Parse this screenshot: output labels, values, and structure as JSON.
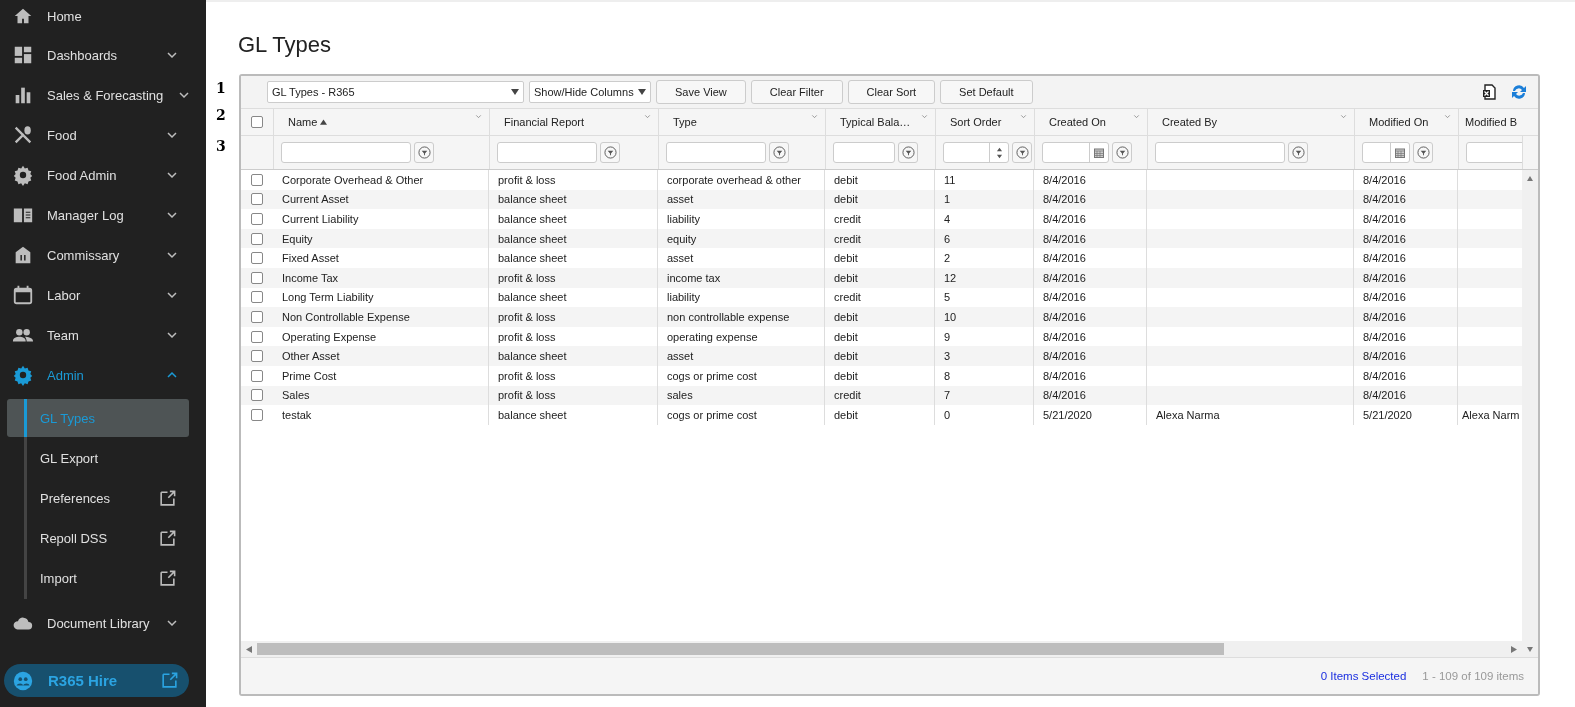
{
  "sidebar": {
    "items": [
      {
        "label": "Home",
        "selected": false
      },
      {
        "label": "Dashboards",
        "selected": false,
        "expanded": false
      },
      {
        "label": "Sales & Forecasting",
        "selected": false,
        "expanded": false
      },
      {
        "label": "Food",
        "selected": false,
        "expanded": false
      },
      {
        "label": "Food Admin",
        "selected": false,
        "expanded": false
      },
      {
        "label": "Manager Log",
        "selected": false,
        "expanded": false
      },
      {
        "label": "Commissary",
        "selected": false,
        "expanded": false
      },
      {
        "label": "Labor",
        "selected": false,
        "expanded": false
      },
      {
        "label": "Team",
        "selected": false,
        "expanded": false
      },
      {
        "label": "Admin",
        "selected": true,
        "expanded": true,
        "children": [
          {
            "label": "GL Types",
            "selected": true,
            "external": false
          },
          {
            "label": "GL Export",
            "selected": false,
            "external": false
          },
          {
            "label": "Preferences",
            "selected": false,
            "external": true
          },
          {
            "label": "Repoll DSS",
            "selected": false,
            "external": true
          },
          {
            "label": "Import",
            "selected": false,
            "external": true
          }
        ]
      },
      {
        "label": "Document Library",
        "selected": false,
        "expanded": false
      }
    ]
  },
  "hire_button": {
    "label": "R365 Hire"
  },
  "page_title": "GL Types",
  "row_markers": [
    "1",
    "2",
    "3"
  ],
  "toolbar": {
    "view_select": "GL Types - R365",
    "columns_menu": "Show/Hide Columns",
    "buttons": [
      "Save View",
      "Clear Filter",
      "Clear Sort",
      "Set Default"
    ]
  },
  "grid": {
    "select_all": {
      "checked": false
    },
    "columns": [
      {
        "label": "Name",
        "sorted": true,
        "kind": "text"
      },
      {
        "label": "Financial Report",
        "sorted": false,
        "kind": "text"
      },
      {
        "label": "Type",
        "sorted": false,
        "kind": "text"
      },
      {
        "label": "Typical Bala…",
        "sorted": false,
        "kind": "text"
      },
      {
        "label": "Sort Order",
        "sorted": false,
        "kind": "number"
      },
      {
        "label": "Created On",
        "sorted": false,
        "kind": "date"
      },
      {
        "label": "Created By",
        "sorted": false,
        "kind": "text"
      },
      {
        "label": "Modified On",
        "sorted": false,
        "kind": "date"
      },
      {
        "label": "Modified B",
        "sorted": false,
        "kind": "text"
      }
    ],
    "rows": [
      {
        "checked": false,
        "name": "Corporate Overhead & Other",
        "financial_report": "profit & loss",
        "type": "corporate overhead & other",
        "typical_balance": "debit",
        "sort_order": "11",
        "created_on": "8/4/2016",
        "modified_on": "8/4/2016"
      },
      {
        "checked": false,
        "name": "Current Asset",
        "financial_report": "balance sheet",
        "type": "asset",
        "typical_balance": "debit",
        "sort_order": "1",
        "created_on": "8/4/2016",
        "modified_on": "8/4/2016"
      },
      {
        "checked": false,
        "name": "Current Liability",
        "financial_report": "balance sheet",
        "type": "liability",
        "typical_balance": "credit",
        "sort_order": "4",
        "created_on": "8/4/2016",
        "modified_on": "8/4/2016"
      },
      {
        "checked": false,
        "name": "Equity",
        "financial_report": "balance sheet",
        "type": "equity",
        "typical_balance": "credit",
        "sort_order": "6",
        "created_on": "8/4/2016",
        "modified_on": "8/4/2016"
      },
      {
        "checked": false,
        "name": "Fixed Asset",
        "financial_report": "balance sheet",
        "type": "asset",
        "typical_balance": "debit",
        "sort_order": "2",
        "created_on": "8/4/2016",
        "modified_on": "8/4/2016"
      },
      {
        "checked": false,
        "name": "Income Tax",
        "financial_report": "profit & loss",
        "type": "income tax",
        "typical_balance": "debit",
        "sort_order": "12",
        "created_on": "8/4/2016",
        "modified_on": "8/4/2016"
      },
      {
        "checked": false,
        "name": "Long Term Liability",
        "financial_report": "balance sheet",
        "type": "liability",
        "typical_balance": "credit",
        "sort_order": "5",
        "created_on": "8/4/2016",
        "modified_on": "8/4/2016"
      },
      {
        "checked": false,
        "name": "Non Controllable Expense",
        "financial_report": "profit & loss",
        "type": "non controllable expense",
        "typical_balance": "debit",
        "sort_order": "10",
        "created_on": "8/4/2016",
        "modified_on": "8/4/2016"
      },
      {
        "checked": false,
        "name": "Operating Expense",
        "financial_report": "profit & loss",
        "type": "operating expense",
        "typical_balance": "debit",
        "sort_order": "9",
        "created_on": "8/4/2016",
        "modified_on": "8/4/2016"
      },
      {
        "checked": false,
        "name": "Other Asset",
        "financial_report": "balance sheet",
        "type": "asset",
        "typical_balance": "debit",
        "sort_order": "3",
        "created_on": "8/4/2016",
        "modified_on": "8/4/2016"
      },
      {
        "checked": false,
        "name": "Prime Cost",
        "financial_report": "profit & loss",
        "type": "cogs or prime cost",
        "typical_balance": "debit",
        "sort_order": "8",
        "created_on": "8/4/2016",
        "modified_on": "8/4/2016"
      },
      {
        "checked": false,
        "name": "Sales",
        "financial_report": "profit & loss",
        "type": "sales",
        "typical_balance": "credit",
        "sort_order": "7",
        "created_on": "8/4/2016",
        "modified_on": "8/4/2016"
      },
      {
        "checked": false,
        "name": "testak",
        "financial_report": "balance sheet",
        "type": "cogs or prime cost",
        "typical_balance": "debit",
        "sort_order": "0",
        "created_on": "5/21/2020",
        "created_by": "Alexa Narma",
        "modified_on": "5/21/2020",
        "modified_by": "Alexa Narm"
      }
    ]
  },
  "footer": {
    "selected_count": "0 Items Selected",
    "paging": "1 - 109 of 109 items"
  }
}
